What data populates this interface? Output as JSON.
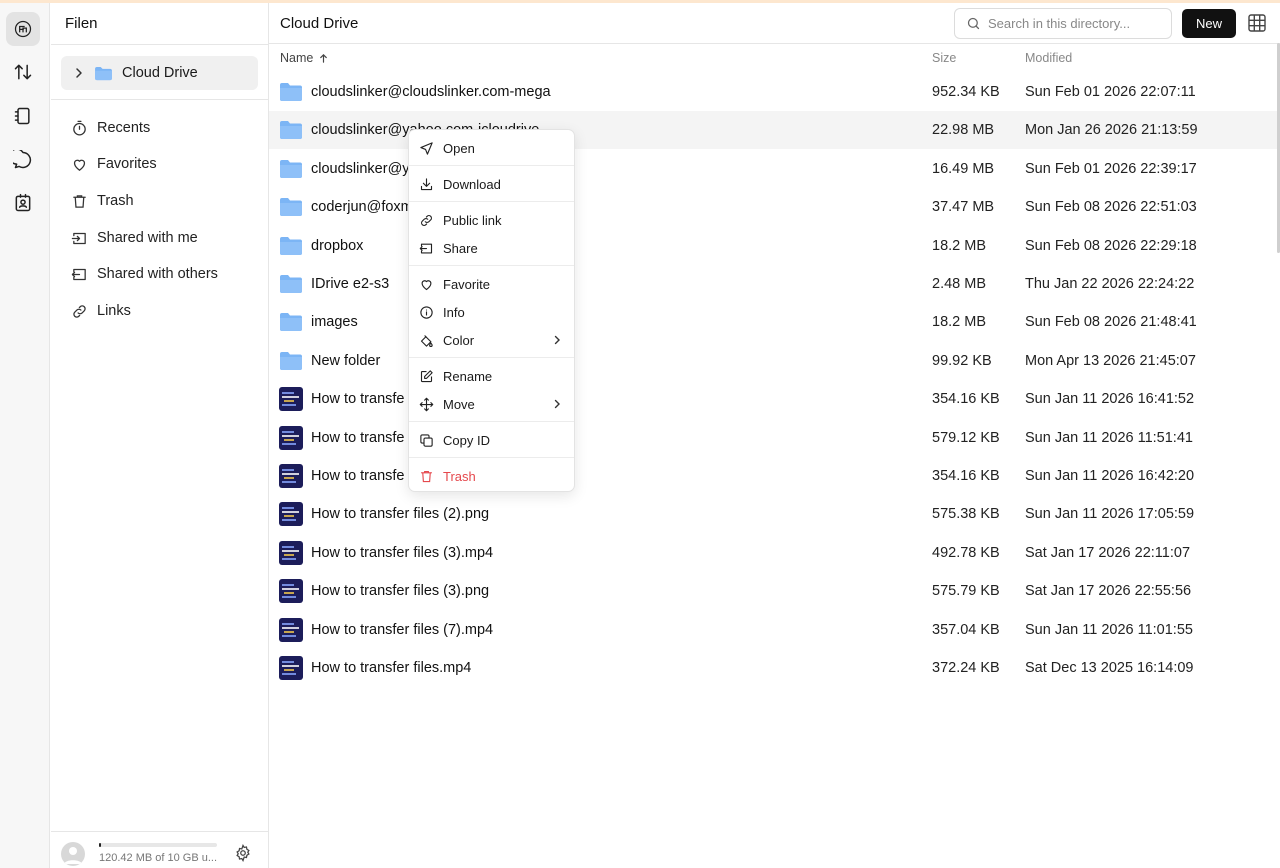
{
  "app": {
    "title": "Filen"
  },
  "sidebar": {
    "tree": {
      "label": "Cloud Drive"
    },
    "items": [
      {
        "label": "Recents",
        "icon": "timer-icon"
      },
      {
        "label": "Favorites",
        "icon": "heart-icon"
      },
      {
        "label": "Trash",
        "icon": "trash-icon"
      },
      {
        "label": "Shared with me",
        "icon": "shared-in-icon"
      },
      {
        "label": "Shared with others",
        "icon": "shared-out-icon"
      },
      {
        "label": "Links",
        "icon": "link-icon"
      }
    ],
    "quota": {
      "text": "120.42 MB of 10 GB u...",
      "fraction": 0.012
    }
  },
  "header": {
    "breadcrumb": "Cloud Drive",
    "search_placeholder": "Search in this directory...",
    "new_label": "New"
  },
  "columns": {
    "name": "Name",
    "size": "Size",
    "modified": "Modified"
  },
  "files": [
    {
      "name": "cloudslinker@cloudslinker.com-mega",
      "size": "952.34 KB",
      "modified": "Sun Feb 01 2026 22:07:11",
      "type": "folder"
    },
    {
      "name": "cloudslinker@yahoo.com-icloudrive",
      "size": "22.98 MB",
      "modified": "Mon Jan 26 2026 21:13:59",
      "type": "folder"
    },
    {
      "name": "cloudslinker@y",
      "size": "16.49 MB",
      "modified": "Sun Feb 01 2026 22:39:17",
      "type": "folder"
    },
    {
      "name": "coderjun@foxm",
      "size": "37.47 MB",
      "modified": "Sun Feb 08 2026 22:51:03",
      "type": "folder"
    },
    {
      "name": "dropbox",
      "size": "18.2 MB",
      "modified": "Sun Feb 08 2026 22:29:18",
      "type": "folder"
    },
    {
      "name": "IDrive e2-s3",
      "size": "2.48 MB",
      "modified": "Thu Jan 22 2026 22:24:22",
      "type": "folder"
    },
    {
      "name": "images",
      "size": "18.2 MB",
      "modified": "Sun Feb 08 2026 21:48:41",
      "type": "folder"
    },
    {
      "name": "New folder",
      "size": "99.92 KB",
      "modified": "Mon Apr 13 2026 21:45:07",
      "type": "folder"
    },
    {
      "name": "How to transfe",
      "size": "354.16 KB",
      "modified": "Sun Jan 11 2026 16:41:52",
      "type": "media"
    },
    {
      "name": "How to transfe",
      "size": "579.12 KB",
      "modified": "Sun Jan 11 2026 11:51:41",
      "type": "media"
    },
    {
      "name": "How to transfe",
      "size": "354.16 KB",
      "modified": "Sun Jan 11 2026 16:42:20",
      "type": "media"
    },
    {
      "name": "How to transfer files (2).png",
      "size": "575.38 KB",
      "modified": "Sun Jan 11 2026 17:05:59",
      "type": "media"
    },
    {
      "name": "How to transfer files (3).mp4",
      "size": "492.78 KB",
      "modified": "Sat Jan 17 2026 22:11:07",
      "type": "media"
    },
    {
      "name": "How to transfer files (3).png",
      "size": "575.79 KB",
      "modified": "Sat Jan 17 2026 22:55:56",
      "type": "media"
    },
    {
      "name": "How to transfer files (7).mp4",
      "size": "357.04 KB",
      "modified": "Sun Jan 11 2026 11:01:55",
      "type": "media"
    },
    {
      "name": "How to transfer files.mp4",
      "size": "372.24 KB",
      "modified": "Sat Dec 13 2025 16:14:09",
      "type": "media"
    }
  ],
  "context_menu": {
    "open": "Open",
    "download": "Download",
    "public_link": "Public link",
    "share": "Share",
    "favorite": "Favorite",
    "info": "Info",
    "color": "Color",
    "rename": "Rename",
    "move": "Move",
    "copy_id": "Copy ID",
    "trash": "Trash"
  },
  "colors": {
    "folder": "#7cb5f5",
    "danger": "#e5484d",
    "primary_button": "#111111"
  }
}
